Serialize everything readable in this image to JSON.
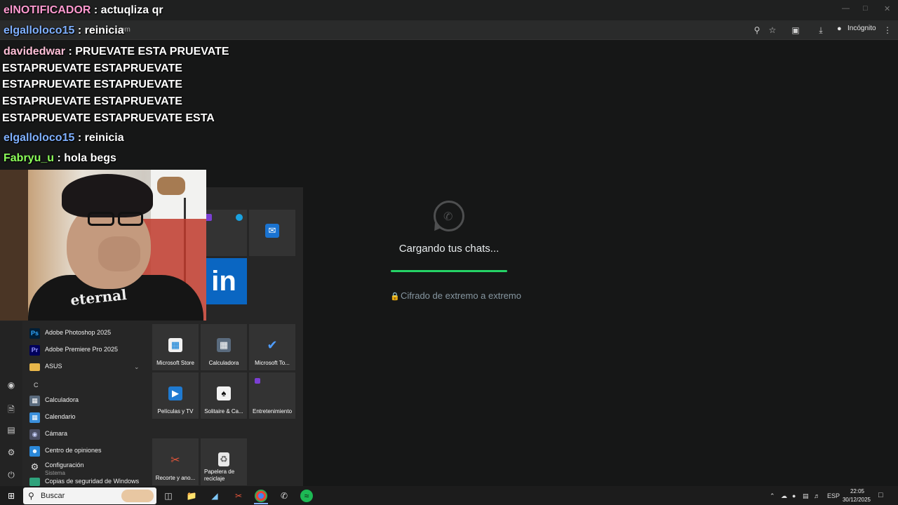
{
  "browser": {
    "url_fragment": "om",
    "incognito_label": "Incógnito",
    "icons": [
      "zoom-icon",
      "star-icon",
      "screenshot-icon",
      "download-icon",
      "incognito-icon",
      "menu-icon"
    ]
  },
  "chat": [
    {
      "user": "elNOTIFICADOR",
      "user_color": "#ff9ad0",
      "text": ": actuqliza qr"
    },
    {
      "user": "elgalloloco15",
      "user_color": "#7fb0ff",
      "text": ": reinicia"
    },
    {
      "user": "davidedwar",
      "user_color": "#ffc0d8",
      "text": ": PRUEVATE ESTA PRUEVATE"
    },
    {
      "continuation": "ESTAPRUEVATE ESTAPRUEVATE"
    },
    {
      "continuation": "ESTAPRUEVATE ESTAPRUEVATE"
    },
    {
      "continuation": "ESTAPRUEVATE ESTAPRUEVATE"
    },
    {
      "continuation": "ESTAPRUEVATE ESTAPRUEVATE ESTA"
    },
    {
      "user": "elgalloloco15",
      "user_color": "#7fb0ff",
      "text": ": reinicia"
    },
    {
      "user": "Fabryu_u",
      "user_color": "#8cff5a",
      "text": ": hola begs"
    }
  ],
  "whatsapp": {
    "loading_text": "Cargando tus chats...",
    "encryption_text": "Cifrado de extremo a extremo",
    "progress": 1.0,
    "accent": "#25d366"
  },
  "start_menu": {
    "apps": [
      {
        "label": "Adobe Photoshop 2025",
        "icon": "Ps",
        "icon_color": "#31a8ff",
        "icon_bg": "#001e36"
      },
      {
        "label": "Adobe Premiere Pro 2025",
        "icon": "Pr",
        "icon_color": "#9999ff",
        "icon_bg": "#00005b"
      },
      {
        "label": "ASUS",
        "icon": "folder-icon"
      },
      {
        "label": "Calculadora",
        "icon": "calculator-icon"
      },
      {
        "label": "Calendario",
        "icon": "calendar-icon"
      },
      {
        "label": "Cámara",
        "icon": "camera-icon"
      },
      {
        "label": "Centro de opiniones",
        "icon": "feedback-icon"
      },
      {
        "label": "Configuración",
        "sublabel": "Sistema",
        "icon": "settings-icon"
      },
      {
        "label": "Copias de seguridad de Windows",
        "icon": "backup-icon"
      }
    ],
    "letter_header": "C",
    "tiles": [
      {
        "label": "Microsoft Store",
        "icon": "store-icon"
      },
      {
        "label": "Calculadora",
        "icon": "calculator-icon"
      },
      {
        "label": "Microsoft To...",
        "icon": "todo-icon"
      },
      {
        "label": "Películas y TV",
        "icon": "movies-icon"
      },
      {
        "label": "Solitaire & Ca...",
        "icon": "solitaire-icon"
      },
      {
        "label": "Entretenimiento",
        "icon": "entertainment-icon"
      },
      {
        "label": "Recorte y ano...",
        "icon": "snip-icon"
      },
      {
        "label": "Papelera de reciclaje",
        "icon": "recycle-bin-icon"
      }
    ],
    "linkedin_tile": "in"
  },
  "taskbar": {
    "search_placeholder": "Buscar",
    "language": "ESP",
    "time": "22:05",
    "date": "30/12/2025"
  }
}
